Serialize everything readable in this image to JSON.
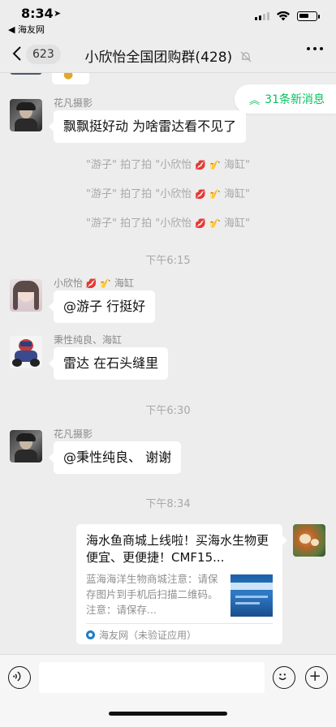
{
  "status": {
    "time": "8:34",
    "back_app": "◀ 海友网"
  },
  "nav": {
    "unread_count": "623",
    "title": "小欣怡全国团购群(428)"
  },
  "new_messages": "31条新消息",
  "messages": [
    {
      "sender": "花凡摄影",
      "text": "飘飘挺好动  为啥雷达看不见了"
    },
    {
      "sender": "小欣怡",
      "sender_suffix": "海缸",
      "text": "@游子 行挺好"
    },
    {
      "sender": "秉性纯良、海缸",
      "text": "雷达 在石头缝里"
    },
    {
      "sender": "花凡摄影",
      "text": "@秉性纯良、 谢谢"
    }
  ],
  "system_lines": [
    {
      "prefix": "\"游子\" 拍了拍 \"小欣怡",
      "suffix": "海缸\""
    },
    {
      "prefix": "\"游子\" 拍了拍 \"小欣怡",
      "suffix": "海缸\""
    },
    {
      "prefix": "\"游子\" 拍了拍 \"小欣怡",
      "suffix": "海缸\""
    }
  ],
  "timestamps": [
    "下午6:15",
    "下午6:30",
    "下午8:34"
  ],
  "link_card": {
    "title": "海水鱼商城上线啦！买海水生物更便宜、更便捷！CMF15...",
    "description": "蓝海海洋生物商城注意：请保存图片到手机后扫描二维码。注意：请保存...",
    "source": "海友网（未验证应用）"
  },
  "colors": {
    "background": "#ededed",
    "bubble": "#ffffff",
    "accent_green": "#07c160",
    "meta_text": "#a8a8a8"
  }
}
